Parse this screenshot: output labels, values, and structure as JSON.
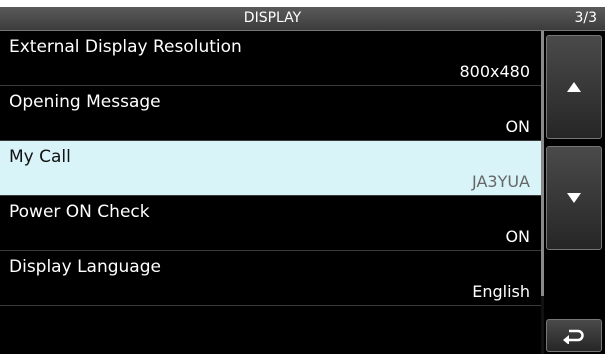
{
  "header": {
    "title": "DISPLAY",
    "page_indicator": "3/3"
  },
  "rows": [
    {
      "label": "External Display Resolution",
      "value": "800x480"
    },
    {
      "label": "Opening Message",
      "value": "ON"
    },
    {
      "label": "My Call",
      "value": "JA3YUA"
    },
    {
      "label": "Power ON Check",
      "value": "ON"
    },
    {
      "label": "Display Language",
      "value": "English"
    }
  ],
  "selected_row": "My Call",
  "icons": {
    "scroll_up": "up-triangle-icon",
    "scroll_down": "down-triangle-icon",
    "back": "return-arrow-icon"
  },
  "colors": {
    "selected_bg": "#d8f4f8",
    "background": "#000000",
    "title_bar": "#4a4a4a"
  }
}
